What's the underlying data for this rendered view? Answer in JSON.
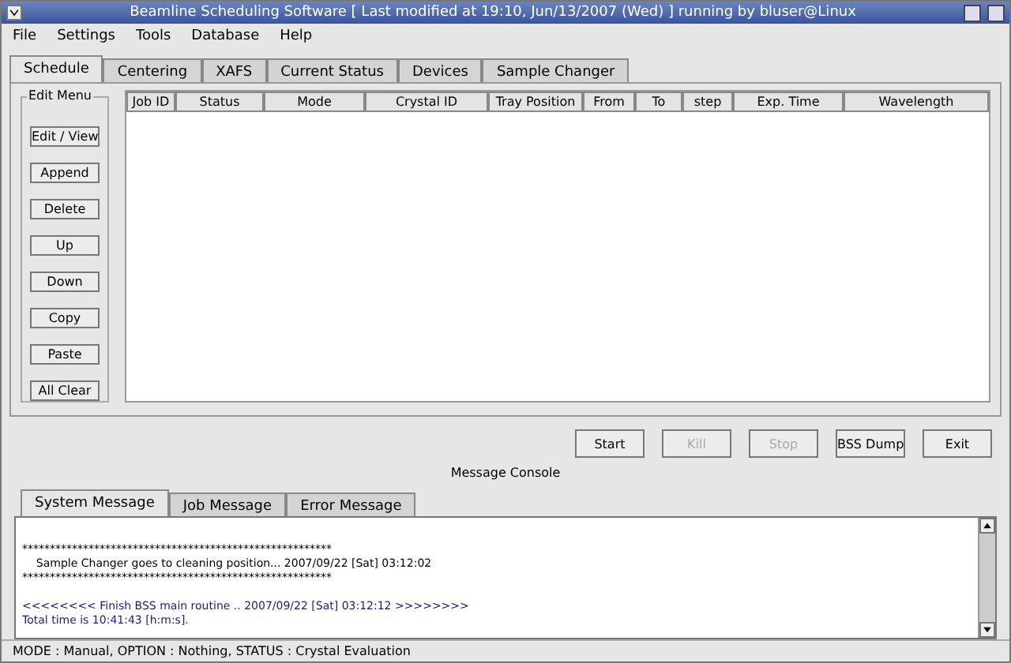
{
  "window": {
    "title": "Beamline Scheduling Software [ Last modified at 19:10, Jun/13/2007 (Wed) ] running by bluser@Linux"
  },
  "menu": [
    {
      "label": "File"
    },
    {
      "label": "Settings"
    },
    {
      "label": "Tools"
    },
    {
      "label": "Database"
    },
    {
      "label": "Help"
    }
  ],
  "tabs": [
    {
      "label": "Schedule",
      "selected": true
    },
    {
      "label": "Centering",
      "selected": false
    },
    {
      "label": "XAFS",
      "selected": false
    },
    {
      "label": "Current Status",
      "selected": false
    },
    {
      "label": "Devices",
      "selected": false
    },
    {
      "label": "Sample Changer",
      "selected": false
    }
  ],
  "edit_menu": {
    "title": "Edit Menu",
    "buttons": [
      "Edit / View",
      "Append",
      "Delete",
      "Up",
      "Down",
      "Copy",
      "Paste",
      "All Clear"
    ]
  },
  "table": {
    "columns": [
      "Job ID",
      "Status",
      "Mode",
      "Crystal ID",
      "Tray Position",
      "From",
      "To",
      "step",
      "Exp. Time",
      "Wavelength"
    ]
  },
  "actions": [
    {
      "label": "Start",
      "disabled": false
    },
    {
      "label": "Kill",
      "disabled": true
    },
    {
      "label": "Stop",
      "disabled": true
    },
    {
      "label": "BSS Dump",
      "disabled": false
    },
    {
      "label": "Exit",
      "disabled": false
    }
  ],
  "console": {
    "title": "Message Console",
    "tabs": [
      {
        "label": "System Message",
        "selected": true
      },
      {
        "label": "Job Message",
        "selected": false
      },
      {
        "label": "Error Message",
        "selected": false
      }
    ],
    "blocks": [
      {
        "lines": [
          {
            "text": "********************************************************",
            "kind": "plain"
          },
          {
            "text": "    Sample Changer goes to cleaning position... 2007/09/22 [Sat] 03:12:02",
            "kind": "plain"
          },
          {
            "text": "********************************************************",
            "kind": "plain"
          }
        ]
      },
      {
        "lines": [
          {
            "text": "<<<<<<<< Finish BSS main routine .. 2007/09/22 [Sat] 03:12:12 >>>>>>>>",
            "kind": "info"
          },
          {
            "text": "Total time is 10:41:43 [h:m:s].",
            "kind": "info"
          }
        ]
      }
    ]
  },
  "status_bar": "MODE : Manual,    OPTION : Nothing,    STATUS : Crystal Evaluation"
}
